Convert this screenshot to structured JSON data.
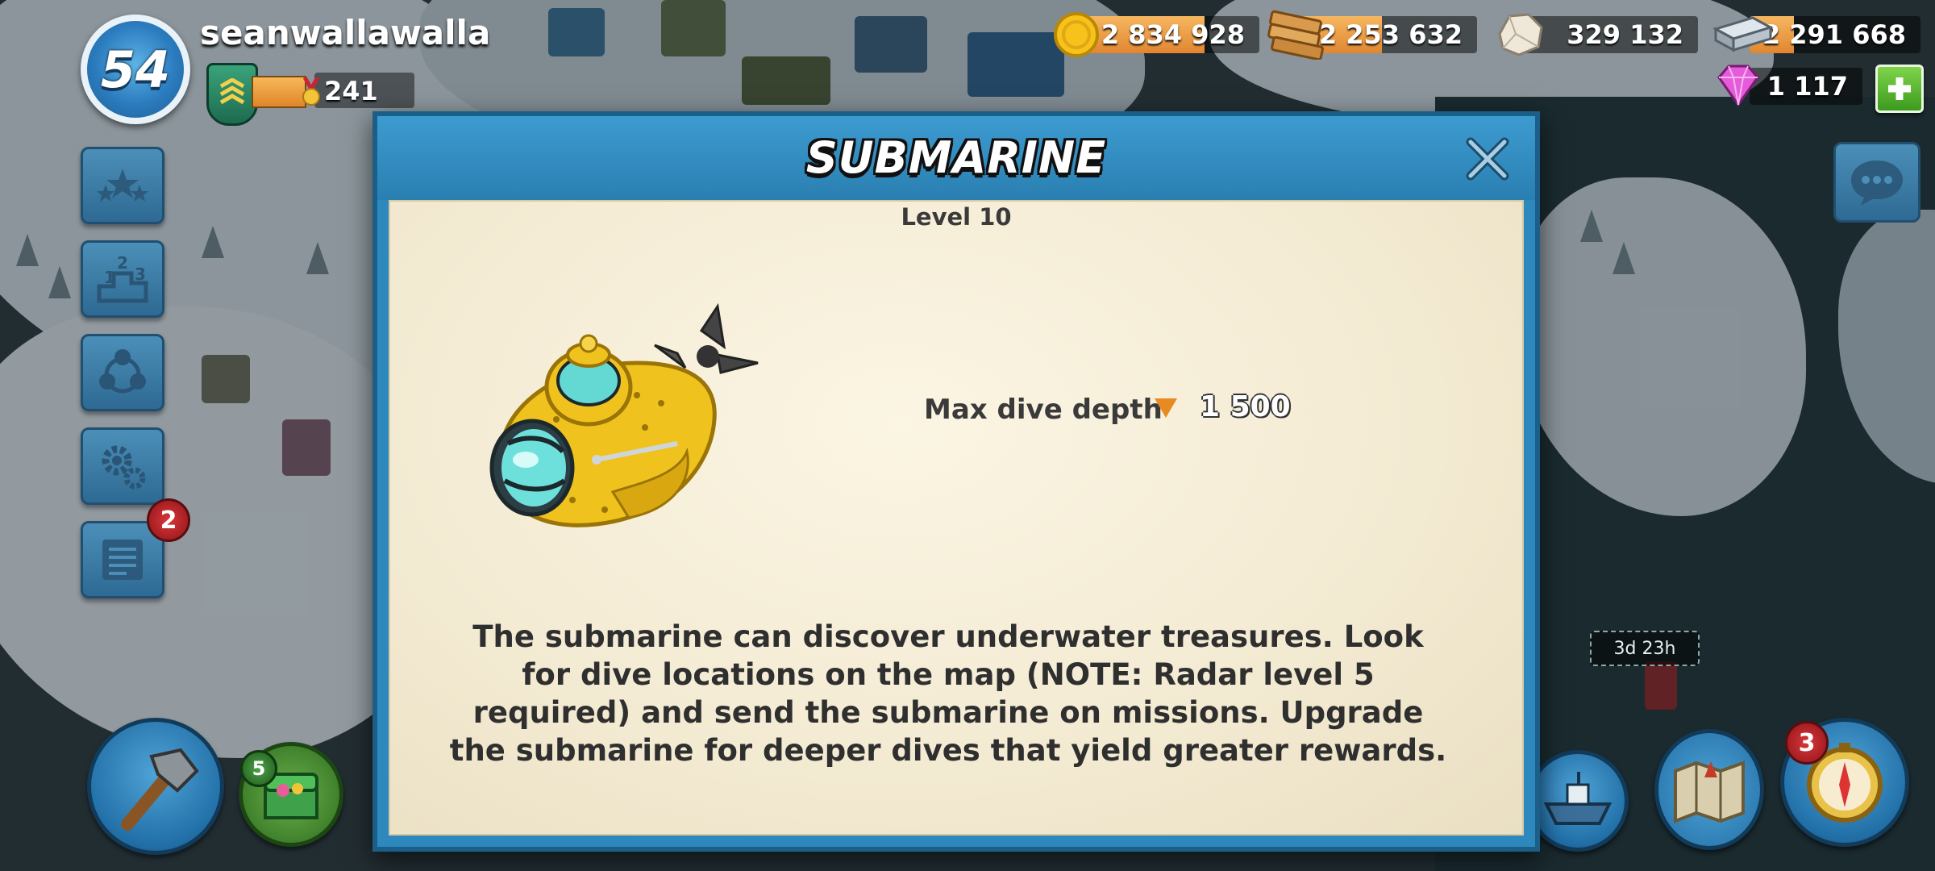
{
  "player": {
    "level": "54",
    "username": "seanwallawalla",
    "medals": "241"
  },
  "resources": {
    "gold": "2 834 928",
    "wood": "2 253 632",
    "stone": "329 132",
    "iron": "2 291 668",
    "diamonds": "1 117"
  },
  "sidebar": {
    "news_badge": "2"
  },
  "bottom": {
    "builder_badge": "5",
    "map_badge": "3",
    "timer": "3d 23h"
  },
  "dialog": {
    "title": "SUBMARINE",
    "level": "Level 10",
    "stat_label": "Max dive depth",
    "stat_value": "1 500",
    "description": "The submarine can discover underwater treasures. Look for dive locations on the map (NOTE: Radar level 5 required) and send the submarine on missions. Upgrade the submarine for deeper dives that yield greater rewards."
  },
  "colors": {
    "dialog_frame": "#2d88bd",
    "panel_bg": "#f3ead2",
    "stat_arrow": "#e88a22",
    "add_button": "#4caf2a",
    "notification_red": "#c8262b"
  },
  "icons": [
    "gold-coin-icon",
    "wood-icon",
    "stone-icon",
    "iron-icon",
    "diamond-icon",
    "plus-icon",
    "close-icon",
    "chat-icon",
    "stars-icon",
    "leaderboard-icon",
    "task-force-icon",
    "gear-icon",
    "newspaper-icon",
    "hammer-icon"
  ]
}
